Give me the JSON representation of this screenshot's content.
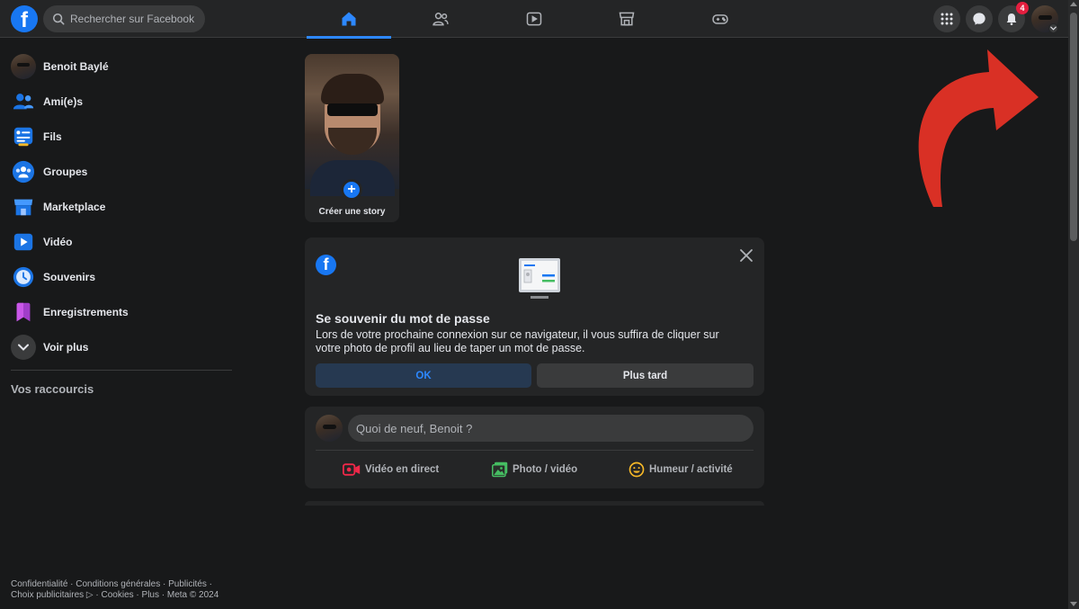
{
  "header": {
    "logo_letter": "f",
    "search_placeholder": "Rechercher sur Facebook",
    "nav_tabs": [
      {
        "icon": "home-icon",
        "active": true
      },
      {
        "icon": "friends-icon",
        "active": false
      },
      {
        "icon": "video-icon",
        "active": false
      },
      {
        "icon": "marketplace-icon",
        "active": false
      },
      {
        "icon": "gaming-icon",
        "active": false
      }
    ],
    "notifications_badge": "4",
    "accent_color": "#2d88ff"
  },
  "sidebar": {
    "items": [
      {
        "label": "Benoit Baylé",
        "icon": "profile-avatar"
      },
      {
        "label": "Ami(e)s",
        "icon": "friends-icon"
      },
      {
        "label": "Fils",
        "icon": "feeds-icon"
      },
      {
        "label": "Groupes",
        "icon": "groups-icon"
      },
      {
        "label": "Marketplace",
        "icon": "marketplace-icon"
      },
      {
        "label": "Vidéo",
        "icon": "video-icon"
      },
      {
        "label": "Souvenirs",
        "icon": "memories-icon"
      },
      {
        "label": "Enregistrements",
        "icon": "saved-icon"
      },
      {
        "label": "Voir plus",
        "icon": "chevron-down-icon"
      }
    ],
    "shortcuts_title": "Vos raccourcis",
    "footer": "Confidentialité · Conditions générales · Publicités · Choix publicitaires ▷ · Cookies · Plus · Meta © 2024"
  },
  "story": {
    "label": "Créer une story",
    "plus": "+"
  },
  "password_card": {
    "logo_letter": "f",
    "title": "Se souvenir du mot de passe",
    "text": "Lors de votre prochaine connexion sur ce navigateur, il vous suffira de cliquer sur votre photo de profil au lieu de taper un mot de passe.",
    "ok_label": "OK",
    "later_label": "Plus tard"
  },
  "composer": {
    "placeholder": "Quoi de neuf, Benoit ?",
    "actions": [
      {
        "label": "Vidéo en direct",
        "icon": "live-video-icon",
        "color": "#f02849"
      },
      {
        "label": "Photo / vidéo",
        "icon": "photo-icon",
        "color": "#45bd62"
      },
      {
        "label": "Humeur / activité",
        "icon": "feeling-icon",
        "color": "#f7b928"
      }
    ]
  },
  "annotation": {
    "arrow_color": "#d93025"
  }
}
